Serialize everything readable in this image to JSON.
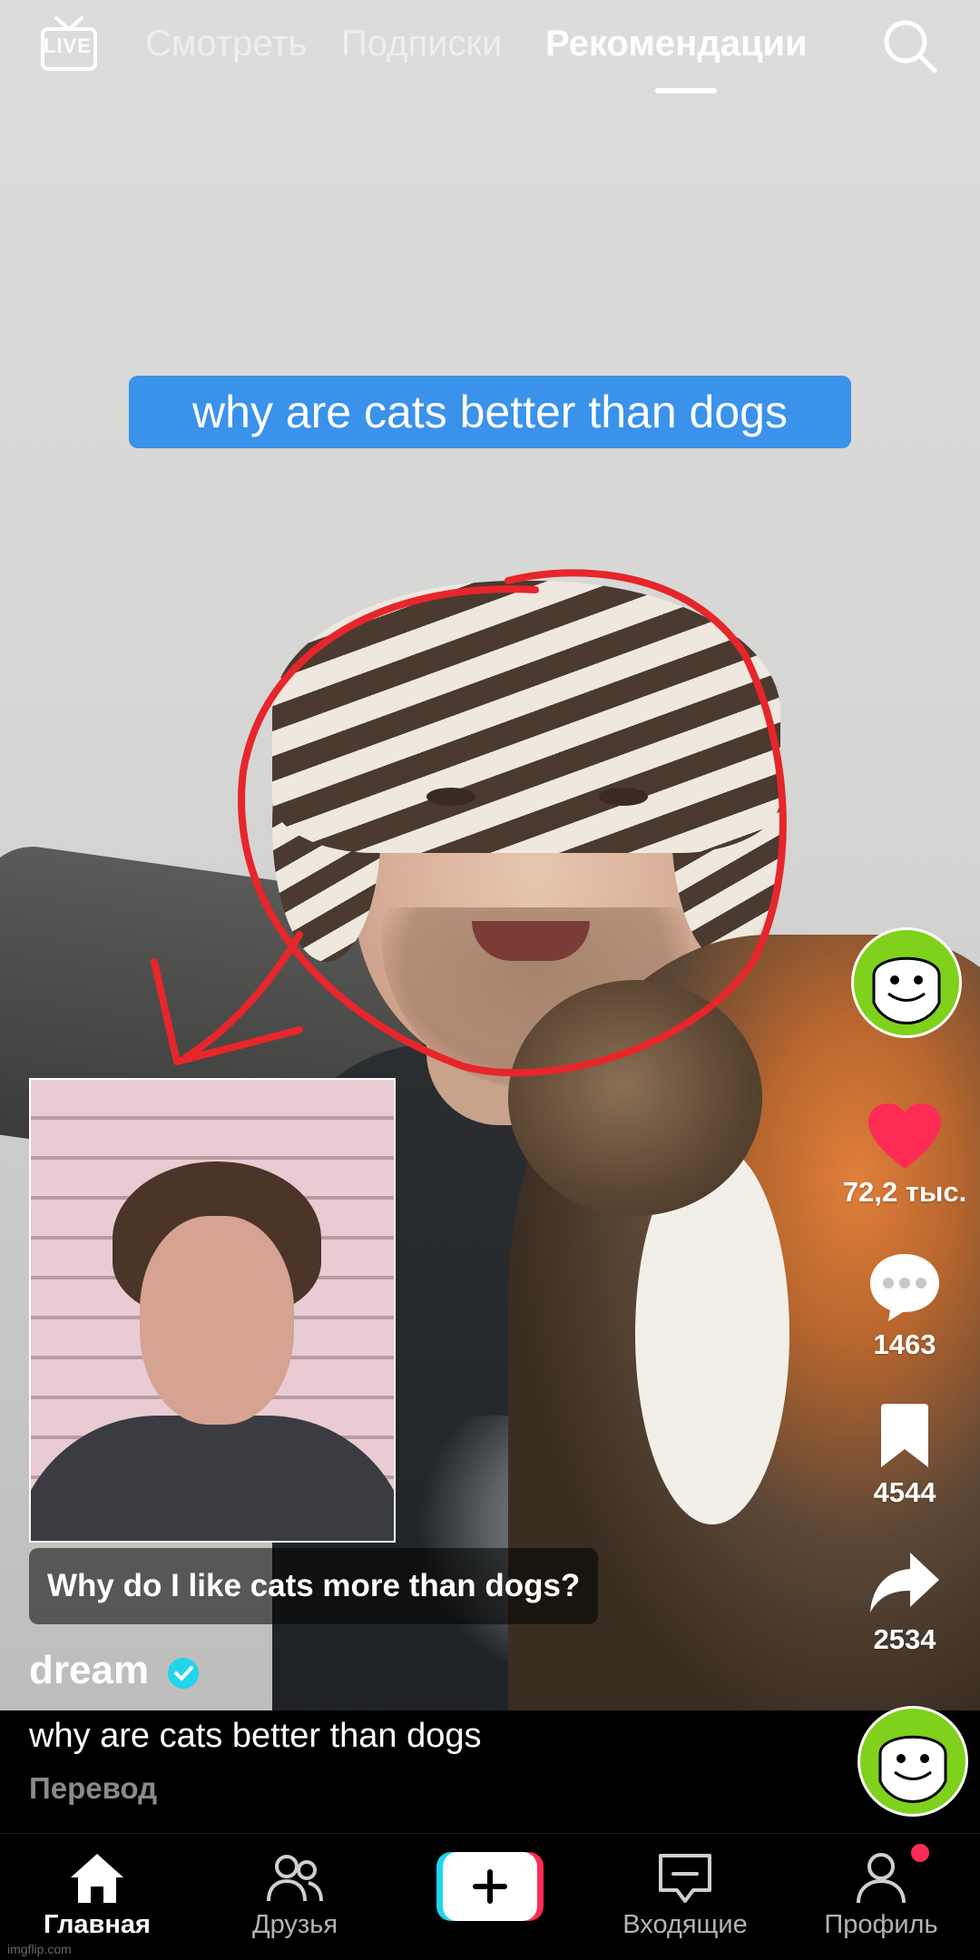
{
  "top_bar": {
    "live_label": "LIVE",
    "tabs": [
      {
        "label": "Смотреть",
        "active": false
      },
      {
        "label": "Подписки",
        "active": false
      },
      {
        "label": "Рекомендации",
        "active": true
      }
    ],
    "search_icon": "search-icon"
  },
  "video": {
    "overlay_caption": "why are cats better than dogs",
    "question_text": "Why do I like cats more than dogs?",
    "annotation_color": "#e6262b"
  },
  "author": {
    "username": "dream",
    "verified": true,
    "verified_color": "#20d5ec"
  },
  "description": {
    "text": "why are cats better than dogs",
    "translate_label": "Перевод"
  },
  "actions": {
    "likes": "72,2 тыс.",
    "comments": "1463",
    "bookmarks": "4544",
    "shares": "2534",
    "like_color": "#fe2c55"
  },
  "bottom_nav": {
    "home": "Главная",
    "friends": "Друзья",
    "inbox": "Входящие",
    "profile": "Профиль"
  },
  "watermark": "imgflip.com",
  "colors": {
    "caption_bg": "#3a92ea",
    "avatar_bg": "#7fd11c",
    "accent_red": "#fe2c55",
    "accent_cyan": "#20d5ec"
  }
}
